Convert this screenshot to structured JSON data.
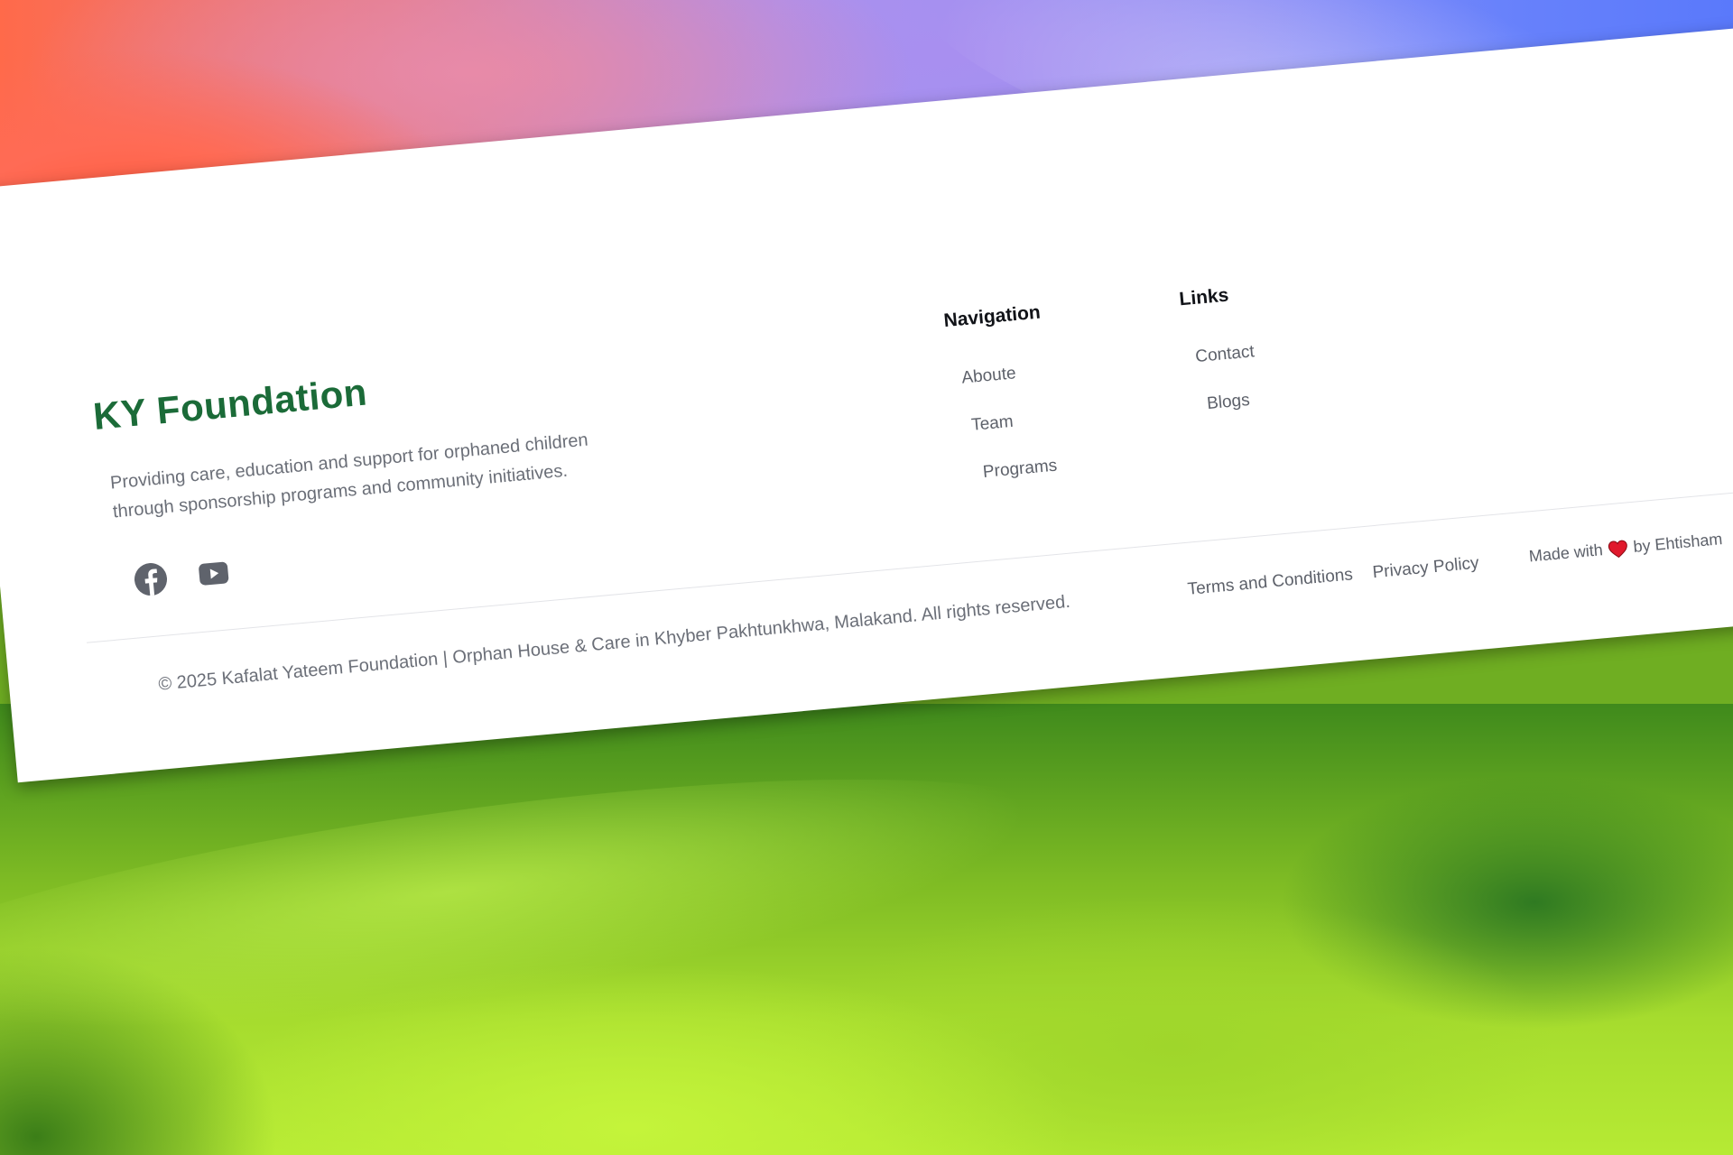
{
  "brand": {
    "name": "KY Foundation",
    "tagline_line1": "Providing care, education and support for orphaned children",
    "tagline_line2": "through sponsorship programs and community initiatives.",
    "color": "#1b6b38"
  },
  "social": {
    "icons": [
      "facebook-icon",
      "youtube-icon"
    ]
  },
  "navigation": {
    "heading": "Navigation",
    "items": [
      {
        "label": "Aboute"
      },
      {
        "label": "Team"
      },
      {
        "label": "Programs"
      }
    ]
  },
  "links": {
    "heading": "Links",
    "items": [
      {
        "label": "Contact"
      },
      {
        "label": "Blogs"
      }
    ]
  },
  "footer": {
    "copyright": "© 2025 Kafalat Yateem Foundation | Orphan House & Care in Khyber Pakhtunkhwa, Malakand. All rights reserved.",
    "terms": "Terms and Conditions",
    "privacy": "Privacy Policy",
    "made_prefix": "Made with",
    "made_suffix": "by Ehtisham",
    "heart_color": "#e0192c"
  }
}
